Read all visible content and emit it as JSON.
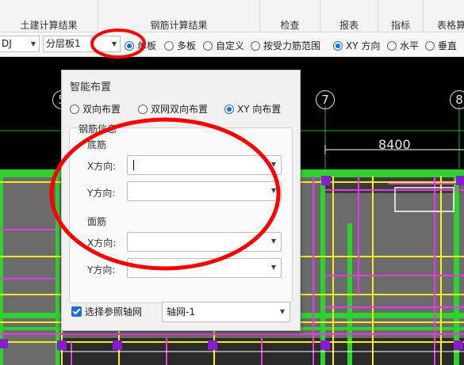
{
  "ribbon": {
    "groups": [
      "土建计算结果",
      "钢筋计算结果",
      "检查",
      "报表",
      "指标",
      "表格算"
    ]
  },
  "toolbar": {
    "combo1_value": "DJ",
    "combo2_value": "分层板1",
    "radios": [
      {
        "label": "单板",
        "checked": true
      },
      {
        "label": "多板",
        "checked": false
      },
      {
        "label": "自定义",
        "checked": false
      },
      {
        "label": "按受力筋范围",
        "checked": false
      },
      {
        "label": "XY 方向",
        "checked": true
      },
      {
        "label": "水平",
        "checked": false
      },
      {
        "label": "垂直",
        "checked": false
      }
    ]
  },
  "canvas": {
    "axis_labels": [
      "5",
      "7",
      "8"
    ],
    "dimension": "8400"
  },
  "dialog": {
    "title": "智能布置",
    "modes": [
      {
        "label": "双向布置",
        "checked": false
      },
      {
        "label": "双网双向布置",
        "checked": false
      },
      {
        "label": "XY 向布置",
        "checked": true
      }
    ],
    "group_title": "钢筋信息",
    "bottom_title": "底筋",
    "top_title": "面筋",
    "x_label": "X方向:",
    "y_label": "Y方向:",
    "ref_axis_label": "选择参照轴网",
    "ref_axis_value": "轴网-1"
  }
}
